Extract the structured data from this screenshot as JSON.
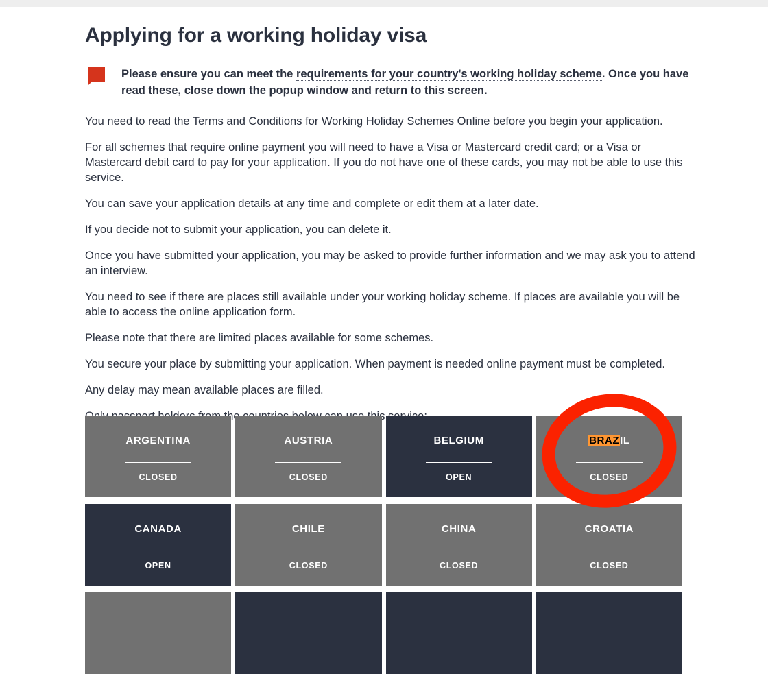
{
  "page": {
    "title": "Applying for a working holiday visa"
  },
  "notice": {
    "icon": "speech-bubble-icon",
    "text_before": "Please ensure you can meet the ",
    "link_text": "requirements for your country's working holiday scheme",
    "text_after": ". Once you have read these, close down the popup window and return to this screen."
  },
  "paragraphs": {
    "p1_before": "You need to read the ",
    "p1_link": "Terms and Conditions for Working Holiday Schemes Online",
    "p1_after": " before you begin your application.",
    "p2": "For all schemes that require online payment you will need to have a Visa or Mastercard credit card; or a Visa or Mastercard debit card to pay for your application. If you do not have one of these cards, you may not be able to use this service.",
    "p3": "You can save your application details at any time and complete or edit them at a later date.",
    "p4": "If you decide not to submit your application, you can delete it.",
    "p5": "Once you have submitted your application, you may be asked to provide further information and we may ask you to attend an interview.",
    "p6": "You need to see if there are places still available under your working holiday scheme. If places are available you will be able to access the online application form.",
    "p7": "Please note that there are limited places available for some schemes.",
    "p8": "You secure your place by submitting your application. When payment is needed online payment must be completed.",
    "p9": "Any delay may mean available places are filled.",
    "p10": "Only passport holders from the countries below can use this service:"
  },
  "countries": [
    {
      "name": "ARGENTINA",
      "status": "CLOSED",
      "open": false
    },
    {
      "name": "AUSTRIA",
      "status": "CLOSED",
      "open": false
    },
    {
      "name": "BELGIUM",
      "status": "OPEN",
      "open": true
    },
    {
      "name": "BRAZIL",
      "status": "CLOSED",
      "open": false,
      "highlight": "BRAZ",
      "highlight_rest": "IL"
    },
    {
      "name": "CANADA",
      "status": "OPEN",
      "open": true
    },
    {
      "name": "CHILE",
      "status": "CLOSED",
      "open": false
    },
    {
      "name": "CHINA",
      "status": "CLOSED",
      "open": false
    },
    {
      "name": "CROATIA",
      "status": "CLOSED",
      "open": false
    },
    {
      "name": "",
      "status": "",
      "open": false
    },
    {
      "name": "",
      "status": "",
      "open": true
    },
    {
      "name": "",
      "status": "",
      "open": true
    },
    {
      "name": "",
      "status": "",
      "open": true
    }
  ],
  "colors": {
    "text_dark": "#2b313f",
    "tile_closed": "#717171",
    "tile_open": "#2b3140",
    "notice_icon": "#d5341c",
    "highlight_bg": "#ff9632",
    "annotation_red": "#fb2200",
    "top_strip": "#eeeeee"
  },
  "annotation": {
    "type": "ellipse-highlight",
    "target": "BRAZIL"
  }
}
